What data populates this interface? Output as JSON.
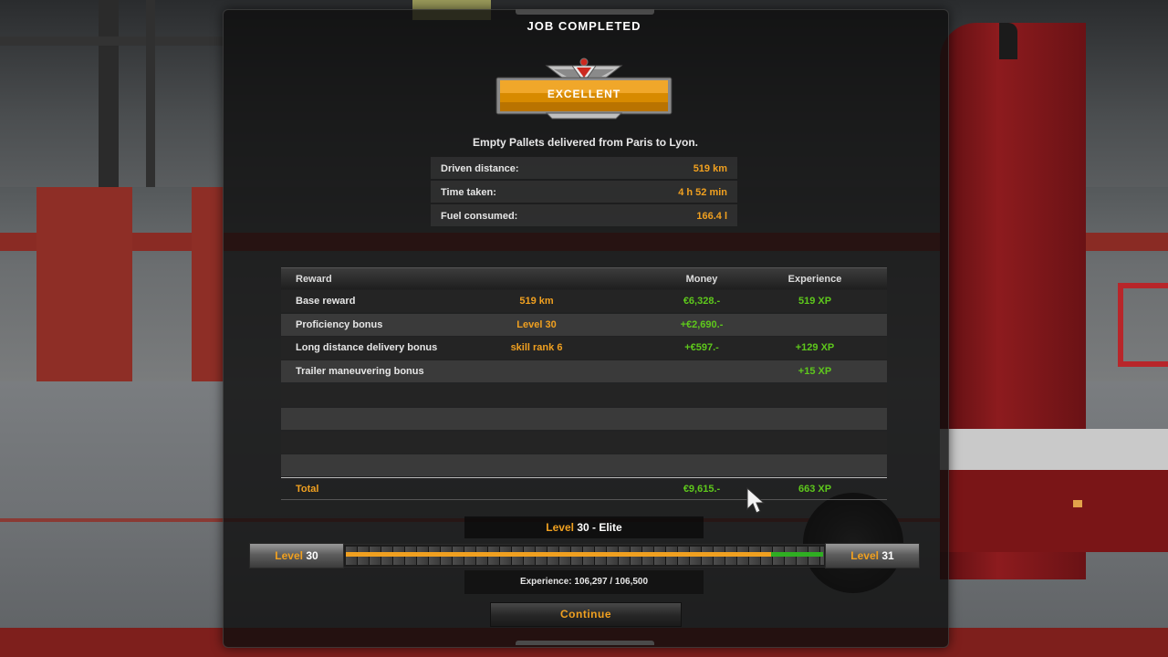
{
  "dialog": {
    "title": "JOB COMPLETED",
    "rating": "EXCELLENT",
    "delivery_summary": "Empty Pallets delivered from Paris to Lyon."
  },
  "stats": [
    {
      "label": "Driven distance:",
      "value": "519 km"
    },
    {
      "label": "Time taken:",
      "value": "4 h 52 min"
    },
    {
      "label": "Fuel consumed:",
      "value": "166.4 l"
    }
  ],
  "rewards": {
    "headers": {
      "reward": "Reward",
      "money": "Money",
      "experience": "Experience"
    },
    "rows": [
      {
        "name": "Base reward",
        "detail": "519 km",
        "money": "€6,328.-",
        "xp": "519 XP"
      },
      {
        "name": "Proficiency bonus",
        "detail": "Level 30",
        "money": "+€2,690.-",
        "xp": ""
      },
      {
        "name": "Long distance delivery bonus",
        "detail": "skill rank 6",
        "money": "+€597.-",
        "xp": "+129 XP"
      },
      {
        "name": "Trailer maneuvering bonus",
        "detail": "",
        "money": "",
        "xp": "+15 XP"
      }
    ],
    "total": {
      "name": "Total",
      "money": "€9,615.-",
      "xp": "663 XP"
    }
  },
  "level": {
    "title_prefix": "Level",
    "title_rest": "30 - Elite",
    "current_word": "Level",
    "current_num": "30",
    "next_word": "Level",
    "next_num": "31",
    "experience_text": "Experience: 106,297 / 106,500",
    "progress_before": 0.89,
    "progress_after": 0.998
  },
  "buttons": {
    "continue": "Continue"
  },
  "colors": {
    "accent_orange": "#f0a020",
    "money_green": "#5ec81c",
    "xp_gain_green": "#2fae22",
    "panel": "#0e0e0e"
  },
  "icons": {
    "rating_emblem": "excellent-badge-icon",
    "cursor": "mouse-pointer-icon"
  }
}
